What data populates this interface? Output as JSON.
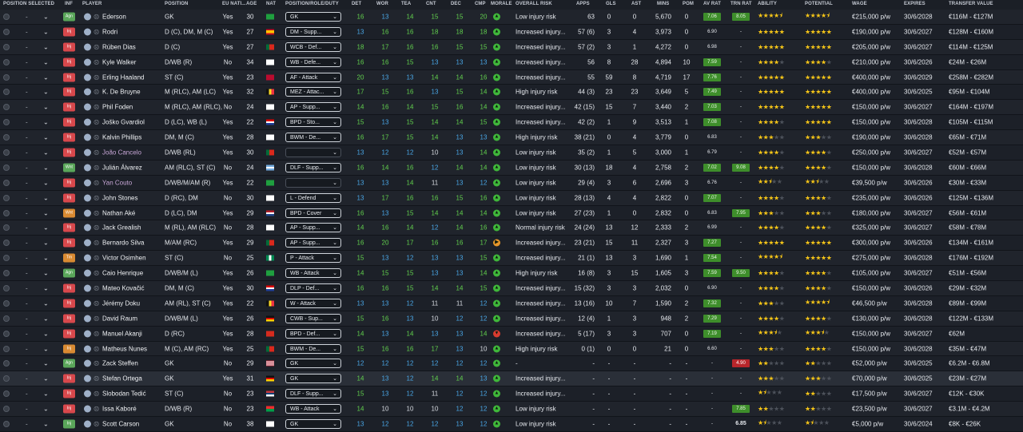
{
  "headers": {
    "position_selected": "POSITION SELECTED",
    "inf": "INF",
    "player": "PLAYER",
    "position": "POSITION",
    "eu_nat": "EU NATI...",
    "age": "AGE",
    "nat": "NAT",
    "role": "POSITION/ROLE/DUTY",
    "det": "DET",
    "wor": "WOR",
    "tea": "TEA",
    "cnt": "CNT",
    "dec": "DEC",
    "cmp": "CMP",
    "morale": "MORALE",
    "risk": "OVERALL RISK",
    "apps": "APPS",
    "gls": "GLS",
    "ast": "AST",
    "mins": "MINS",
    "pom": "POM",
    "avr": "AV RAT",
    "trn": "TRN RAT",
    "ability": "ABILITY",
    "potential": "POTENTIAL",
    "wage": "WAGE",
    "expires": "EXPIRES",
    "tv": "TRANSFER VALUE"
  },
  "colors": {
    "inf_red": "#d8484c",
    "inf_green": "#5aa65a",
    "inf_orange": "#d98a32",
    "morale_green": "#3fb73a",
    "morale_orange": "#e6962a",
    "morale_red": "#d93b2f",
    "rating_green": "#3e8e2b",
    "rating_red": "#b8262b",
    "star": "#f5c518"
  },
  "players": [
    {
      "sel": "-",
      "inf": "Agn",
      "infc": "green",
      "name": "Ederson",
      "pos": "GK",
      "eu": "Yes",
      "age": "30",
      "nat": "br",
      "role": "GK",
      "det": "16",
      "wor": "13",
      "tea": "14",
      "cnt": "15",
      "dec": "15",
      "cmp": "20",
      "mor": "green",
      "risk": "Low injury risk",
      "apps": "63",
      "gls": "0",
      "ast": "0",
      "mins": "5,670",
      "pom": "0",
      "avr": "7.06",
      "avrb": true,
      "trn": "8.05",
      "trnt": "box",
      "ab": 4.5,
      "pot": 4.5,
      "wage": "€215,000 p/w",
      "exp": "30/6/2028",
      "tv": "€116M - €127M"
    },
    {
      "sel": "-",
      "inf": "Inj",
      "infc": "red",
      "name": "Rodri",
      "pos": "D (C), DM, M (C)",
      "eu": "Yes",
      "age": "27",
      "nat": "es",
      "role": "DM - Supp...",
      "det": "13",
      "wor": "16",
      "tea": "16",
      "cnt": "18",
      "dec": "18",
      "cmp": "18",
      "mor": "green",
      "risk": "Increased injury...",
      "apps": "57 (6)",
      "gls": "3",
      "ast": "4",
      "mins": "3,973",
      "pom": "0",
      "avr": "6.90",
      "avrb": false,
      "trn": "-",
      "trnt": "",
      "ab": 5,
      "pot": 5,
      "wage": "€190,000 p/w",
      "exp": "30/6/2027",
      "tv": "€128M - €160M"
    },
    {
      "sel": "-",
      "inf": "Inj",
      "infc": "red",
      "name": "Rúben Dias",
      "pos": "D (C)",
      "eu": "Yes",
      "age": "27",
      "nat": "pt",
      "role": "WCB - Def...",
      "det": "18",
      "wor": "17",
      "tea": "16",
      "cnt": "16",
      "dec": "15",
      "cmp": "15",
      "mor": "green",
      "risk": "Increased injury...",
      "apps": "57 (2)",
      "gls": "3",
      "ast": "1",
      "mins": "4,272",
      "pom": "0",
      "avr": "6.98",
      "avrb": false,
      "trn": "-",
      "trnt": "",
      "ab": 5,
      "pot": 5,
      "wage": "€205,000 p/w",
      "exp": "30/6/2027",
      "tv": "€114M - €125M"
    },
    {
      "sel": "-",
      "inf": "Inj",
      "infc": "red",
      "name": "Kyle Walker",
      "pos": "D/WB (R)",
      "eu": "No",
      "age": "34",
      "nat": "en",
      "role": "WB - Defe...",
      "det": "16",
      "wor": "16",
      "tea": "15",
      "cnt": "13",
      "dec": "13",
      "cmp": "13",
      "mor": "green",
      "risk": "Increased injury...",
      "apps": "56",
      "gls": "8",
      "ast": "28",
      "mins": "4,894",
      "pom": "10",
      "avr": "7.59",
      "avrb": true,
      "trn": "-",
      "trnt": "",
      "ab": 4,
      "pot": 4,
      "wage": "€210,000 p/w",
      "exp": "30/6/2026",
      "tv": "€24M - €26M"
    },
    {
      "sel": "-",
      "inf": "Inj",
      "infc": "red",
      "name": "Erling Haaland",
      "pos": "ST (C)",
      "eu": "Yes",
      "age": "23",
      "nat": "no",
      "role": "AF - Attack",
      "det": "20",
      "wor": "13",
      "tea": "13",
      "cnt": "14",
      "dec": "14",
      "cmp": "16",
      "mor": "green",
      "risk": "Increased injury...",
      "apps": "55",
      "gls": "59",
      "ast": "8",
      "mins": "4,719",
      "pom": "17",
      "avr": "7.76",
      "avrb": true,
      "trn": "-",
      "trnt": "",
      "ab": 5,
      "pot": 5,
      "wage": "€400,000 p/w",
      "exp": "30/6/2029",
      "tv": "€258M - €282M"
    },
    {
      "sel": "-",
      "inf": "Inj",
      "infc": "red",
      "name": "K. De Bruyne",
      "pos": "M (RLC), AM (LC)",
      "eu": "Yes",
      "age": "32",
      "nat": "be",
      "role": "MEZ - Attac...",
      "det": "17",
      "wor": "15",
      "tea": "16",
      "cnt": "13",
      "dec": "15",
      "cmp": "14",
      "mor": "green",
      "risk": "High injury risk",
      "apps": "44 (3)",
      "gls": "23",
      "ast": "23",
      "mins": "3,649",
      "pom": "5",
      "avr": "7.49",
      "avrb": true,
      "trn": "-",
      "trnt": "",
      "ab": 5,
      "pot": 5,
      "wage": "€400,000 p/w",
      "exp": "30/6/2025",
      "tv": "€95M - €104M"
    },
    {
      "sel": "-",
      "inf": "Inj",
      "infc": "red",
      "name": "Phil Foden",
      "pos": "M (RLC), AM (RLC), S...",
      "eu": "No",
      "age": "24",
      "nat": "en",
      "role": "AP - Supp...",
      "det": "14",
      "wor": "16",
      "tea": "14",
      "cnt": "15",
      "dec": "16",
      "cmp": "14",
      "mor": "green",
      "risk": "Increased injury...",
      "apps": "42 (15)",
      "gls": "15",
      "ast": "7",
      "mins": "3,440",
      "pom": "2",
      "avr": "7.03",
      "avrb": true,
      "trn": "-",
      "trnt": "",
      "ab": 5,
      "pot": 5,
      "wage": "€150,000 p/w",
      "exp": "30/6/2027",
      "tv": "€164M - €197M"
    },
    {
      "sel": "-",
      "inf": "Inj",
      "infc": "red",
      "name": "Joško Gvardiol",
      "pos": "D (LC), WB (L)",
      "eu": "Yes",
      "age": "22",
      "nat": "hr",
      "role": "BPD - Sto...",
      "det": "15",
      "wor": "13",
      "tea": "15",
      "cnt": "14",
      "dec": "14",
      "cmp": "15",
      "mor": "green",
      "risk": "Increased injury...",
      "apps": "42 (2)",
      "gls": "1",
      "ast": "9",
      "mins": "3,513",
      "pom": "1",
      "avr": "7.08",
      "avrb": true,
      "trn": "-",
      "trnt": "",
      "ab": 4,
      "pot": 5,
      "wage": "€150,000 p/w",
      "exp": "30/6/2028",
      "tv": "€105M - €115M"
    },
    {
      "sel": "-",
      "inf": "Inj",
      "infc": "red",
      "name": "Kalvin Phillips",
      "pos": "DM, M (C)",
      "eu": "Yes",
      "age": "28",
      "nat": "en",
      "role": "BWM - De...",
      "det": "16",
      "wor": "17",
      "tea": "15",
      "cnt": "14",
      "dec": "13",
      "cmp": "13",
      "mor": "green",
      "risk": "High injury risk",
      "apps": "38 (21)",
      "gls": "0",
      "ast": "4",
      "mins": "3,779",
      "pom": "0",
      "avr": "6.83",
      "avrb": false,
      "trn": "-",
      "trnt": "",
      "ab": 3,
      "pot": 3,
      "wage": "€190,000 p/w",
      "exp": "30/6/2028",
      "tv": "€65M - €71M"
    },
    {
      "sel": "-",
      "inf": "Inj",
      "infc": "red",
      "name": "João Cancelo",
      "loan": true,
      "pos": "D/WB (RL)",
      "eu": "Yes",
      "age": "30",
      "nat": "pt",
      "role": "",
      "det": "13",
      "wor": "12",
      "tea": "12",
      "cnt": "10",
      "dec": "13",
      "cmp": "14",
      "mor": "green",
      "risk": "Low injury risk",
      "apps": "35 (2)",
      "gls": "1",
      "ast": "5",
      "mins": "3,000",
      "pom": "1",
      "avr": "6.79",
      "avrb": false,
      "trn": "-",
      "trnt": "",
      "ab": 4,
      "pot": 4,
      "wage": "€250,000 p/w",
      "exp": "30/6/2027",
      "tv": "€52M - €57M"
    },
    {
      "sel": "-",
      "inf": "Wnt",
      "infc": "green",
      "name": "Julián Álvarez",
      "pos": "AM (RLC), ST (C)",
      "eu": "No",
      "age": "24",
      "nat": "ar",
      "role": "DLF - Supp...",
      "det": "16",
      "wor": "14",
      "tea": "16",
      "cnt": "12",
      "dec": "14",
      "cmp": "14",
      "mor": "green",
      "risk": "Low injury risk",
      "apps": "30 (13)",
      "gls": "18",
      "ast": "4",
      "mins": "2,758",
      "pom": "2",
      "avr": "7.02",
      "avrb": true,
      "trn": "9.08",
      "trnt": "box",
      "ab": 4,
      "pot": 4,
      "wage": "€150,000 p/w",
      "exp": "30/6/2028",
      "tv": "€60M - €66M"
    },
    {
      "sel": "-",
      "inf": "Inj",
      "infc": "red",
      "name": "Yan Couto",
      "loan": true,
      "pos": "D/WB/M/AM (R)",
      "eu": "Yes",
      "age": "22",
      "nat": "br",
      "role": "",
      "det": "13",
      "wor": "13",
      "tea": "14",
      "cnt": "11",
      "dec": "13",
      "cmp": "12",
      "mor": "green",
      "risk": "Low injury risk",
      "apps": "29 (4)",
      "gls": "3",
      "ast": "6",
      "mins": "2,696",
      "pom": "3",
      "avr": "6.76",
      "avrb": false,
      "trn": "-",
      "trnt": "",
      "ab": 2.5,
      "pot": 2.5,
      "wage": "€39,500 p/w",
      "exp": "30/6/2026",
      "tv": "€30M - €33M"
    },
    {
      "sel": "-",
      "inf": "Inj",
      "infc": "red",
      "name": "John Stones",
      "pos": "D (RC), DM",
      "eu": "No",
      "age": "30",
      "nat": "en",
      "role": "L - Defend",
      "det": "13",
      "wor": "17",
      "tea": "16",
      "cnt": "16",
      "dec": "15",
      "cmp": "16",
      "mor": "green",
      "risk": "Low injury risk",
      "apps": "28 (13)",
      "gls": "4",
      "ast": "4",
      "mins": "2,822",
      "pom": "0",
      "avr": "7.07",
      "avrb": true,
      "trn": "-",
      "trnt": "",
      "ab": 4,
      "pot": 4,
      "wage": "€235,000 p/w",
      "exp": "30/6/2026",
      "tv": "€125M - €136M"
    },
    {
      "sel": "-",
      "inf": "Wnt",
      "infc": "orange",
      "name": "Nathan Aké",
      "pos": "D (LC), DM",
      "eu": "Yes",
      "age": "29",
      "nat": "nl",
      "role": "BPD - Cover",
      "det": "16",
      "wor": "13",
      "tea": "15",
      "cnt": "14",
      "dec": "14",
      "cmp": "14",
      "mor": "green",
      "risk": "Low injury risk",
      "apps": "27 (23)",
      "gls": "1",
      "ast": "0",
      "mins": "2,832",
      "pom": "0",
      "avr": "6.83",
      "avrb": false,
      "trn": "7.95",
      "trnt": "box",
      "ab": 3,
      "pot": 3,
      "wage": "€180,000 p/w",
      "exp": "30/6/2027",
      "tv": "€56M - €61M"
    },
    {
      "sel": "-",
      "inf": "Inj",
      "infc": "red",
      "name": "Jack Grealish",
      "pos": "M (RL), AM (RLC)",
      "eu": "No",
      "age": "28",
      "nat": "en",
      "role": "AP - Supp...",
      "det": "14",
      "wor": "16",
      "tea": "14",
      "cnt": "12",
      "dec": "14",
      "cmp": "16",
      "mor": "green",
      "risk": "Normal injury risk",
      "apps": "24 (24)",
      "gls": "13",
      "ast": "12",
      "mins": "2,333",
      "pom": "2",
      "avr": "6.99",
      "avrb": false,
      "trn": "-",
      "trnt": "",
      "ab": 4,
      "pot": 4,
      "wage": "€325,000 p/w",
      "exp": "30/6/2027",
      "tv": "€58M - €78M"
    },
    {
      "sel": "-",
      "inf": "Inj",
      "infc": "red",
      "name": "Bernardo Silva",
      "pos": "M/AM (RC)",
      "eu": "Yes",
      "age": "29",
      "nat": "pt",
      "role": "AP - Supp...",
      "det": "16",
      "wor": "20",
      "tea": "17",
      "cnt": "16",
      "dec": "16",
      "cmp": "17",
      "mor": "orange",
      "risk": "Increased injury...",
      "apps": "23 (21)",
      "gls": "15",
      "ast": "11",
      "mins": "2,327",
      "pom": "3",
      "avr": "7.27",
      "avrb": true,
      "trn": "-",
      "trnt": "",
      "ab": 5,
      "pot": 5,
      "wage": "€300,000 p/w",
      "exp": "30/6/2026",
      "tv": "€134M - €161M"
    },
    {
      "sel": "-",
      "inf": "Trn",
      "infc": "orange",
      "name": "Victor Osimhen",
      "pos": "ST (C)",
      "eu": "No",
      "age": "25",
      "nat": "ng",
      "role": "P - Attack",
      "det": "15",
      "wor": "13",
      "tea": "12",
      "cnt": "13",
      "dec": "13",
      "cmp": "15",
      "mor": "green",
      "risk": "Increased injury...",
      "apps": "21 (1)",
      "gls": "13",
      "ast": "3",
      "mins": "1,690",
      "pom": "1",
      "avr": "7.54",
      "avrb": true,
      "trn": "-",
      "trnt": "",
      "ab": 4.5,
      "pot": 5,
      "wage": "€275,000 p/w",
      "exp": "30/6/2028",
      "tv": "€176M - €192M"
    },
    {
      "sel": "-",
      "inf": "Agn",
      "infc": "green",
      "name": "Caio Henrique",
      "pos": "D/WB/M (L)",
      "eu": "Yes",
      "age": "26",
      "nat": "br",
      "role": "WB - Attack",
      "det": "14",
      "wor": "15",
      "tea": "15",
      "cnt": "13",
      "dec": "13",
      "cmp": "14",
      "mor": "green",
      "risk": "High injury risk",
      "apps": "16 (8)",
      "gls": "3",
      "ast": "15",
      "mins": "1,605",
      "pom": "3",
      "avr": "7.59",
      "avrb": true,
      "trn": "9.50",
      "trnt": "box",
      "ab": 4,
      "pot": 4,
      "wage": "€105,000 p/w",
      "exp": "30/6/2027",
      "tv": "€51M - €56M"
    },
    {
      "sel": "-",
      "inf": "Inj",
      "infc": "red",
      "name": "Mateo Kovačić",
      "pos": "DM, M (C)",
      "eu": "Yes",
      "age": "30",
      "nat": "hr",
      "role": "DLP - Def...",
      "det": "16",
      "wor": "16",
      "tea": "15",
      "cnt": "14",
      "dec": "14",
      "cmp": "15",
      "mor": "green",
      "risk": "Increased injury...",
      "apps": "15 (32)",
      "gls": "3",
      "ast": "3",
      "mins": "2,032",
      "pom": "0",
      "avr": "6.90",
      "avrb": false,
      "trn": "-",
      "trnt": "",
      "ab": 4,
      "pot": 4,
      "wage": "€150,000 p/w",
      "exp": "30/6/2026",
      "tv": "€29M - €32M"
    },
    {
      "sel": "-",
      "inf": "Inj",
      "infc": "red",
      "name": "Jérémy Doku",
      "pos": "AM (RL), ST (C)",
      "eu": "Yes",
      "age": "22",
      "nat": "be",
      "role": "W - Attack",
      "det": "13",
      "wor": "13",
      "tea": "12",
      "cnt": "11",
      "dec": "11",
      "cmp": "12",
      "mor": "green",
      "risk": "Increased injury...",
      "apps": "13 (16)",
      "gls": "10",
      "ast": "7",
      "mins": "1,590",
      "pom": "2",
      "avr": "7.32",
      "avrb": true,
      "trn": "-",
      "trnt": "",
      "ab": 3,
      "pot": 4.5,
      "wage": "€46,500 p/w",
      "exp": "30/6/2028",
      "tv": "€89M - €99M"
    },
    {
      "sel": "-",
      "inf": "Inj",
      "infc": "red",
      "name": "David Raum",
      "pos": "D/WB/M (L)",
      "eu": "Yes",
      "age": "26",
      "nat": "de",
      "role": "CWB - Sup...",
      "det": "15",
      "wor": "16",
      "tea": "13",
      "cnt": "10",
      "dec": "12",
      "cmp": "12",
      "mor": "green",
      "risk": "Increased injury...",
      "apps": "12 (4)",
      "gls": "1",
      "ast": "3",
      "mins": "948",
      "pom": "2",
      "avr": "7.29",
      "avrb": true,
      "trn": "-",
      "trnt": "",
      "ab": 4,
      "pot": 4,
      "wage": "€130,000 p/w",
      "exp": "30/6/2028",
      "tv": "€122M - €133M"
    },
    {
      "sel": "-",
      "inf": "Inj",
      "infc": "red",
      "name": "Manuel Akanji",
      "pos": "D (RC)",
      "eu": "Yes",
      "age": "28",
      "nat": "ch",
      "role": "BPD - Def...",
      "det": "14",
      "wor": "13",
      "tea": "14",
      "cnt": "13",
      "dec": "13",
      "cmp": "14",
      "mor": "red",
      "risk": "Increased injury...",
      "apps": "5 (17)",
      "gls": "3",
      "ast": "3",
      "mins": "707",
      "pom": "0",
      "avr": "7.19",
      "avrb": true,
      "trn": "-",
      "trnt": "",
      "ab": 3.5,
      "pot": 3.5,
      "wage": "€150,000 p/w",
      "exp": "30/6/2027",
      "tv": "€62M"
    },
    {
      "sel": "-",
      "inf": "Inj",
      "infc": "orange",
      "name": "Matheus Nunes",
      "pos": "M (C), AM (RC)",
      "eu": "Yes",
      "age": "25",
      "nat": "pt",
      "role": "BWM - De...",
      "det": "15",
      "wor": "16",
      "tea": "16",
      "cnt": "17",
      "dec": "13",
      "cmp": "10",
      "mor": "green",
      "risk": "High injury risk",
      "apps": "0 (1)",
      "gls": "0",
      "ast": "0",
      "mins": "21",
      "pom": "0",
      "avr": "6.60",
      "avrb": false,
      "trn": "-",
      "trnt": "",
      "ab": 3,
      "pot": 4,
      "wage": "€150,000 p/w",
      "exp": "30/6/2028",
      "tv": "€35M - €47M"
    },
    {
      "sel": "-",
      "inf": "Agn",
      "infc": "green",
      "name": "Zack Steffen",
      "pos": "GK",
      "eu": "No",
      "age": "29",
      "nat": "us",
      "role": "GK",
      "det": "12",
      "wor": "12",
      "tea": "12",
      "cnt": "12",
      "dec": "12",
      "cmp": "12",
      "mor": "green",
      "risk": "-",
      "apps": "-",
      "gls": "-",
      "ast": "-",
      "mins": "-",
      "pom": "-",
      "avr": "-",
      "avrb": false,
      "trn": "4.90",
      "trnt": "red",
      "ab": 2,
      "pot": 2,
      "wage": "€52,000 p/w",
      "exp": "30/6/2025",
      "tv": "€6.2M - €6.8M"
    },
    {
      "sel": "-",
      "inf": "Inj",
      "infc": "red",
      "name": "Stefan Ortega",
      "pos": "GK",
      "eu": "Yes",
      "age": "31",
      "nat": "de",
      "role": "GK",
      "det": "14",
      "wor": "13",
      "tea": "12",
      "cnt": "14",
      "dec": "14",
      "cmp": "13",
      "mor": "green",
      "risk": "Increased injury...",
      "apps": "-",
      "gls": "-",
      "ast": "-",
      "mins": "-",
      "pom": "-",
      "avr": "-",
      "avrb": false,
      "trn": "-",
      "trnt": "",
      "ab": 3,
      "pot": 3,
      "wage": "€70,000 p/w",
      "exp": "30/6/2025",
      "tv": "€23M - €27M",
      "selected": true
    },
    {
      "sel": "-",
      "inf": "Inj",
      "infc": "red",
      "name": "Slobodan Tedić",
      "pos": "ST (C)",
      "eu": "No",
      "age": "23",
      "nat": "rs",
      "role": "DLF - Supp...",
      "det": "15",
      "wor": "13",
      "tea": "12",
      "cnt": "11",
      "dec": "12",
      "cmp": "12",
      "mor": "green",
      "risk": "Increased injury...",
      "apps": "-",
      "gls": "-",
      "ast": "-",
      "mins": "-",
      "pom": "-",
      "avr": "-",
      "avrb": false,
      "trn": "-",
      "trnt": "",
      "ab": 1.5,
      "pot": 2,
      "wage": "€17,500 p/w",
      "exp": "30/6/2027",
      "tv": "€12K - €30K"
    },
    {
      "sel": "-",
      "inf": "Inj",
      "infc": "red",
      "name": "Issa Kaboré",
      "pos": "D/WB (R)",
      "eu": "No",
      "age": "23",
      "nat": "bf",
      "role": "WB - Attack",
      "det": "14",
      "wor": "10",
      "tea": "10",
      "cnt": "10",
      "dec": "12",
      "cmp": "12",
      "mor": "green",
      "risk": "Low injury risk",
      "apps": "-",
      "gls": "-",
      "ast": "-",
      "mins": "-",
      "pom": "-",
      "avr": "-",
      "avrb": false,
      "trn": "7.85",
      "trnt": "box",
      "ab": 2,
      "pot": 2,
      "wage": "€23,500 p/w",
      "exp": "30/6/2027",
      "tv": "€3.1M - €4.2M"
    },
    {
      "sel": "-",
      "inf": "Inj",
      "infc": "green",
      "name": "Scott Carson",
      "pos": "GK",
      "eu": "No",
      "age": "38",
      "nat": "en",
      "role": "GK",
      "det": "13",
      "wor": "12",
      "tea": "12",
      "cnt": "12",
      "dec": "13",
      "cmp": "12",
      "mor": "green",
      "risk": "Low injury risk",
      "apps": "-",
      "gls": "-",
      "ast": "-",
      "mins": "-",
      "pom": "-",
      "avr": "-",
      "avrb": false,
      "trn": "6.85",
      "trnt": "bold",
      "ab": 1.5,
      "pot": 1.5,
      "wage": "€5,000 p/w",
      "exp": "30/6/2024",
      "tv": "€8K - €26K"
    }
  ]
}
